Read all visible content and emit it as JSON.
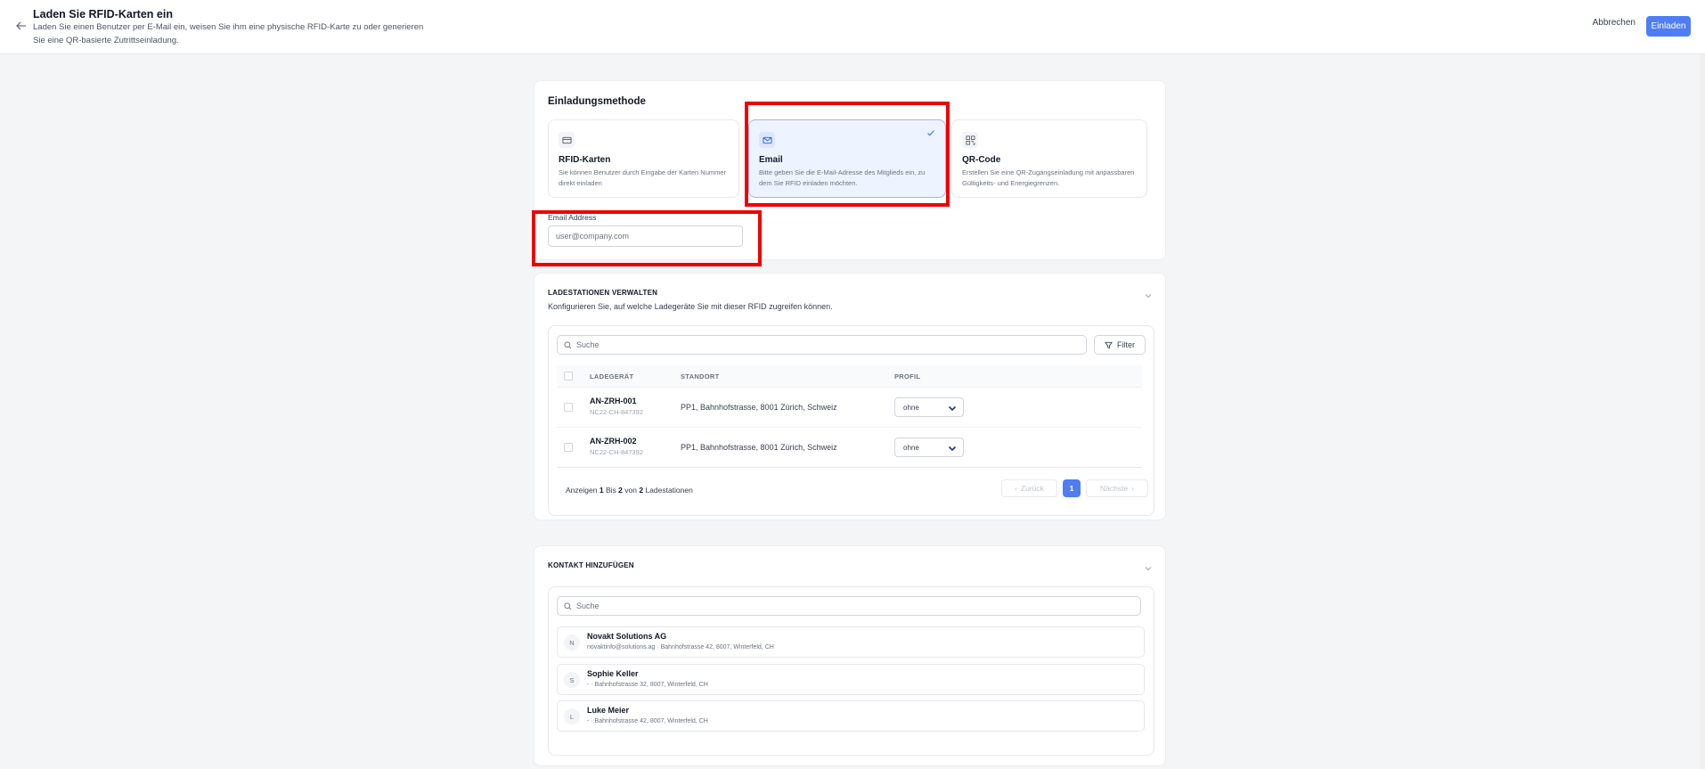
{
  "header": {
    "title": "Laden Sie RFID-Karten ein",
    "subtitle": "Laden Sie einen Benutzer per E-Mail ein, weisen Sie ihm eine physische RFID-Karte zu oder generieren Sie eine QR-basierte Zutrittseinladung.",
    "cancel_label": "Abbrechen",
    "invite_label": "Einladen",
    "accent_color": "#4f7df3"
  },
  "invite_method": {
    "title": "Einladungsmethode",
    "selected": "Email",
    "options": [
      {
        "icon": "credit-card-icon",
        "title": "RFID-Karten",
        "description": "Sie können Benutzer durch Eingabe der Karten Nummer direkt einladen"
      },
      {
        "icon": "mail-icon",
        "title": "Email",
        "description": "Bitte geben Sie die E-Mail-Adresse des Mitglieds ein, zu dem Sie RFID einladen möchten."
      },
      {
        "icon": "qr-code-icon",
        "title": "QR-Code",
        "description": "Erstellen Sie eine QR-Zugangseinladung mit anpassbaren Gültigkeits- und Energiegrenzen."
      }
    ],
    "email_label": "Email Address",
    "email_placeholder": "user@company.com",
    "email_value": ""
  },
  "stations": {
    "heading": "LADESTATIONEN VERWALTEN",
    "subheading": "Konfigurieren Sie, auf welche Ladegeräte Sie mit dieser RFID zugreifen können.",
    "search_placeholder": "Suche",
    "filter_label": "Filter",
    "columns": [
      "LADEGERÄT",
      "STANDORT",
      "PROFIL"
    ],
    "rows": [
      {
        "name": "AN-ZRH-001",
        "id": "NC22-CH-847392",
        "location": "PP1, Bahnhofstrasse, 8001 Zürich, Schweiz",
        "profile": "ohne"
      },
      {
        "name": "AN-ZRH-002",
        "id": "NC22-CH-847392",
        "location": "PP1, Bahnhofstrasse, 8001 Zürich, Schweiz",
        "profile": "ohne"
      }
    ],
    "pagination": {
      "showing_prefix": "Anzeigen",
      "from": "1",
      "to_word": "Bis",
      "to": "2",
      "of_word": "von",
      "total": "2",
      "suffix": "Ladestationen",
      "prev_label": "Zurück",
      "current_page": "1",
      "next_label": "Nächste"
    }
  },
  "contacts": {
    "heading": "KONTAKT HINZUFÜGEN",
    "search_placeholder": "Suche",
    "items": [
      {
        "initial": "N",
        "name": "Novakt Solutions AG",
        "details": "novaktinfo@solutions.ag · Bahnhofstrasse 42, 8007, Winterfeld, CH"
      },
      {
        "initial": "S",
        "name": "Sophie Keller",
        "details": "- · Bahnhofstrasse 32, 8007, Winterfeld, CH"
      },
      {
        "initial": "L",
        "name": "Luke Meier",
        "details": "- · Bahnhofstrasse 42, 8007, Winterfeld, CH"
      }
    ]
  }
}
